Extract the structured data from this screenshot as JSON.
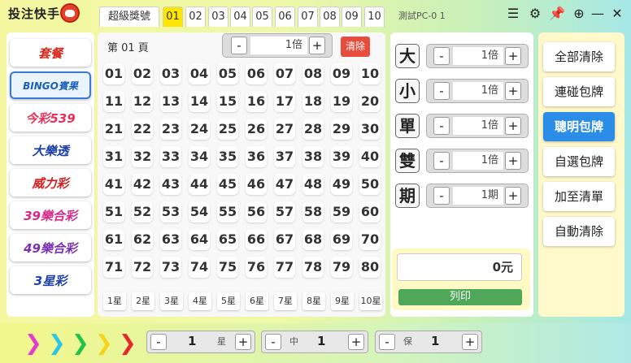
{
  "titlebar": {
    "app_title": "投注快手",
    "tabs": [
      "超級獎號",
      "01",
      "02",
      "03",
      "04",
      "05",
      "06",
      "07",
      "08",
      "09",
      "10"
    ],
    "active_tab": "01",
    "pc_label": "測試PC-0 1",
    "icons": [
      "menu-icon",
      "gear-icon",
      "pin-icon",
      "zoom-in-icon",
      "minimize-icon",
      "close-icon"
    ]
  },
  "lotteries": [
    {
      "label": "套餐",
      "color": "#d8281d"
    },
    {
      "label": "BINGO賓果",
      "color": "#1c5fb8"
    },
    {
      "label": "今彩539",
      "color": "#e8305a"
    },
    {
      "label": "大樂透",
      "color": "#1d3fa8"
    },
    {
      "label": "威力彩",
      "color": "#d81d1d"
    },
    {
      "label": "39樂合彩",
      "color": "#d8288a"
    },
    {
      "label": "49樂合彩",
      "color": "#7a2fb5"
    },
    {
      "label": "3星彩",
      "color": "#1d3fa8"
    }
  ],
  "center": {
    "page_label": "第 01 頁",
    "multiplier": "1倍",
    "clear_label": "清除",
    "numbers": [
      "01",
      "02",
      "03",
      "04",
      "05",
      "06",
      "07",
      "08",
      "09",
      "10",
      "11",
      "12",
      "13",
      "14",
      "15",
      "16",
      "17",
      "18",
      "19",
      "20",
      "21",
      "22",
      "23",
      "24",
      "25",
      "26",
      "27",
      "28",
      "29",
      "30",
      "31",
      "32",
      "33",
      "34",
      "35",
      "36",
      "37",
      "38",
      "39",
      "40",
      "41",
      "42",
      "43",
      "44",
      "45",
      "46",
      "47",
      "48",
      "49",
      "50",
      "51",
      "52",
      "53",
      "54",
      "55",
      "56",
      "57",
      "58",
      "59",
      "60",
      "61",
      "62",
      "63",
      "64",
      "65",
      "66",
      "67",
      "68",
      "69",
      "70",
      "71",
      "72",
      "73",
      "74",
      "75",
      "76",
      "77",
      "78",
      "79",
      "80"
    ],
    "stars": [
      "1星",
      "2星",
      "3星",
      "4星",
      "5星",
      "6星",
      "7星",
      "8星",
      "9星",
      "10星"
    ]
  },
  "bet_types": [
    {
      "label": "大",
      "value": "1倍"
    },
    {
      "label": "小",
      "value": "1倍"
    },
    {
      "label": "單",
      "value": "1倍"
    },
    {
      "label": "雙",
      "value": "1倍"
    },
    {
      "label": "期",
      "value": "1期"
    }
  ],
  "total": "0元",
  "print_label": "列印",
  "actions": [
    "全部清除",
    "連碰包牌",
    "聰明包牌",
    "自選包牌",
    "加至清單",
    "自動清除"
  ],
  "active_action": "聰明包牌",
  "bottom": {
    "arrow_colors": [
      "#e23bd0",
      "#2ec6e6",
      "#23c34a",
      "#f4d41d",
      "#e62a2a"
    ],
    "steppers": [
      {
        "value": "1",
        "unit": "星"
      },
      {
        "prefix": "中",
        "value": "1"
      },
      {
        "prefix": "保",
        "value": "1"
      }
    ]
  }
}
